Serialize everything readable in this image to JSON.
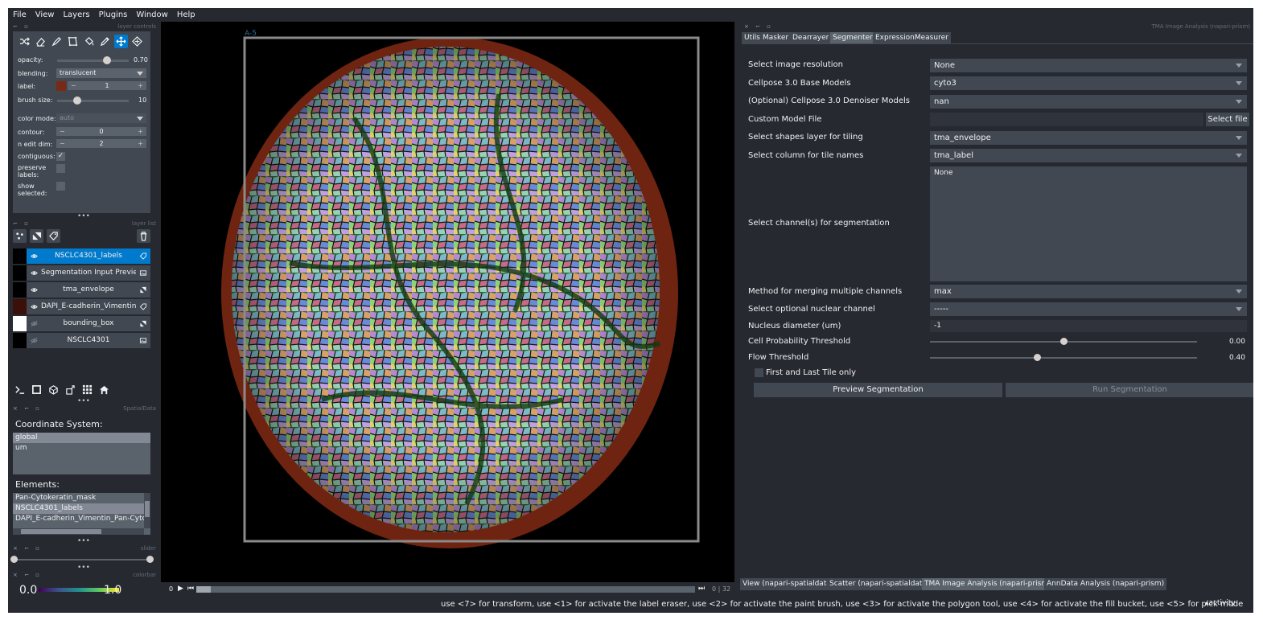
{
  "menubar": [
    "File",
    "View",
    "Layers",
    "Plugins",
    "Window",
    "Help"
  ],
  "dock_titles": {
    "layer_controls": "layer controls",
    "layer_list": "layer list",
    "spatialdata": "SpatialData",
    "slider": "slider",
    "colorbar": "colorbar",
    "right": "TMA Image Analysis (napari-prism)"
  },
  "layer_controls": {
    "opacity_label": "opacity:",
    "opacity_value": "0.70",
    "opacity_fraction": 0.7,
    "blending_label": "blending:",
    "blending_value": "translucent",
    "label_label": "label:",
    "label_value": "1",
    "label_color": "#7a2a12",
    "brush_size_label": "brush size:",
    "brush_size_value": "10",
    "color_mode_label": "color mode:",
    "color_mode_value": "auto",
    "contour_label": "contour:",
    "contour_value": "0",
    "n_edit_dim_label": "n edit dim:",
    "n_edit_dim_value": "2",
    "contiguous_label": "contiguous:",
    "preserve_labels_label": "preserve labels:",
    "show_selected_label": "show selected:",
    "check_mark": "✓",
    "minus": "−",
    "plus": "+"
  },
  "layers": [
    {
      "name": "NSCLC4301_labels",
      "selected": true,
      "visible": true
    },
    {
      "name": "Segmentation Input Preview",
      "selected": false,
      "visible": true
    },
    {
      "name": "tma_envelope",
      "selected": false,
      "visible": true
    },
    {
      "name": "DAPI_E-cadherin_Vimentin...",
      "selected": false,
      "visible": true
    },
    {
      "name": "bounding_box",
      "selected": false,
      "visible": false
    },
    {
      "name": "NSCLC4301",
      "selected": false,
      "visible": false
    }
  ],
  "spatialdata": {
    "coordinate_title": "Coordinate System:",
    "coordinates": [
      "global",
      "um"
    ],
    "elements_title": "Elements:",
    "elements": [
      "Pan-Cytokeratin_mask",
      "NSCLC4301_labels",
      "DAPI_E-cadherin_Vimentin_Pan-Cytoke"
    ]
  },
  "colorbar": {
    "min": "0.0",
    "max": "1.0"
  },
  "canvas": {
    "tile_label": "A-5"
  },
  "dims": {
    "counter": "0 | 32",
    "index": "0"
  },
  "right_tabs": [
    "Utils",
    "Masker",
    "Dearrayer",
    "Segmenter",
    "ExpressionMeasurer"
  ],
  "active_tab": "Segmenter",
  "form": {
    "resolution_label": "Select image resolution",
    "resolution_value": "None",
    "base_models_label": "Cellpose 3.0 Base Models",
    "base_models_value": "cyto3",
    "denoiser_label": "(Optional) Cellpose 3.0 Denoiser Models",
    "denoiser_value": "nan",
    "custom_model_label": "Custom Model File",
    "select_file": "Select file",
    "shapes_label": "Select shapes layer for tiling",
    "shapes_value": "tma_envelope",
    "column_label": "Select column for tile names",
    "column_value": "tma_label",
    "channels_label": "Select channel(s) for segmentation",
    "channels_value": "None",
    "merge_label": "Method for merging multiple channels",
    "merge_value": "max",
    "nuclear_label": "Select optional nuclear channel",
    "nuclear_value": "-----",
    "diameter_label": "Nucleus diameter (um)",
    "diameter_value": "-1",
    "cellprob_label": "Cell Probability Threshold",
    "cellprob_value": "0.00",
    "cellprob_fraction": 0.5,
    "flow_label": "Flow Threshold",
    "flow_value": "0.40",
    "flow_fraction": 0.4,
    "first_last_label": "First and Last Tile only",
    "preview_button": "Preview Segmentation",
    "run_button": "Run Segmentation"
  },
  "bottom_tabs": [
    "View (napari-spatialdata)",
    "Scatter (napari-spatialdata)",
    "TMA Image Analysis (napari-prism)",
    "AnnData Analysis (napari-prism)"
  ],
  "active_bottom_tab": "TMA Image Analysis (napari-prism)",
  "status": {
    "message": "use <7> for transform, use <1> for activate the label eraser, use <2> for activate the paint brush, use <3> for activate the polygon tool, use <4> for activate the fill bucket, use <5> for pick mode",
    "activity": "activity"
  },
  "colors": {
    "bg": "#262930",
    "panel": "#414851",
    "accent": "#007acc",
    "envelope": "#6e2410"
  }
}
